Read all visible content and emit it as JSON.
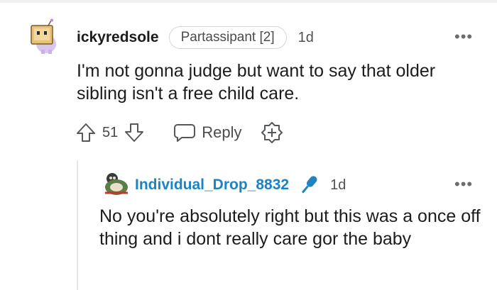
{
  "parent_comment": {
    "username": "ickyredsole",
    "flair": "Partassipant [2]",
    "time": "1d",
    "more": "•••",
    "body": "I'm not gonna judge but want to say that older sibling isn't a free child care.",
    "votes": "51",
    "reply_label": "Reply"
  },
  "reply_comment": {
    "username": "Individual_Drop_8832",
    "time": "1d",
    "more": "•••",
    "body": "No you're absolutely right but this was a once off thing and i dont really care gor the baby"
  },
  "colors": {
    "username_reply": "#1d83c3",
    "mic_icon": "#1d83c3",
    "flair_border": "#d3d6da",
    "thread_line": "#e4e6e8"
  },
  "icons": [
    "upvote-icon",
    "downvote-icon",
    "reply-bubble-icon",
    "award-plus-icon",
    "microphone-icon",
    "more-options-icon"
  ]
}
